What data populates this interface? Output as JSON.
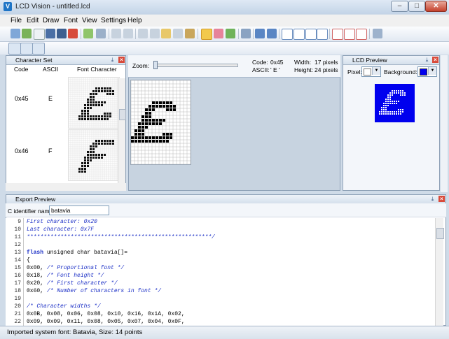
{
  "window": {
    "title": "LCD Vision - untitled.lcd",
    "app_icon_letter": "V"
  },
  "menu": [
    "File",
    "Edit",
    "Draw",
    "Font",
    "View",
    "Settings",
    "Help"
  ],
  "charset": {
    "title": "Character Set",
    "headers": {
      "code": "Code",
      "ascii": "ASCII",
      "font_character": "Font Character"
    },
    "rows": [
      {
        "code": "0x45",
        "ascii": "E"
      },
      {
        "code": "0x46",
        "ascii": "F"
      }
    ]
  },
  "editor": {
    "zoom_label": "Zoom:",
    "code_label": "Code:",
    "code_value": "0x45",
    "ascii_label": "ASCII:",
    "ascii_value": "' E '",
    "width_label": "Width:",
    "width_value": "17 pixels",
    "height_label": "Height:",
    "height_value": "24 pixels"
  },
  "preview": {
    "title": "LCD Preview",
    "pixel_label": "Pixel:",
    "background_label": "Background:",
    "pixel_color": "#ffffff",
    "background_color": "#0000ee"
  },
  "export": {
    "title": "Export Preview",
    "identifier_label": "C identifier name:",
    "identifier_value": "batavia",
    "lines": [
      {
        "n": "9",
        "text": "First character: 0x20",
        "style": "com"
      },
      {
        "n": "10",
        "text": "Last character: 0x7F",
        "style": "com"
      },
      {
        "n": "11",
        "text": "*******************************************************/",
        "style": "com"
      },
      {
        "n": "12",
        "text": "",
        "style": "plain"
      },
      {
        "n": "13",
        "text": "flash unsigned char batavia[]=",
        "style": "kw"
      },
      {
        "n": "14",
        "text": "{",
        "style": "plain"
      },
      {
        "n": "15",
        "text": "0x00, /* Proportional font */",
        "style": "mixed"
      },
      {
        "n": "16",
        "text": "0x18, /* Font height */",
        "style": "mixed"
      },
      {
        "n": "17",
        "text": "0x20, /* First character */",
        "style": "mixed"
      },
      {
        "n": "18",
        "text": "0x60, /* Number of characters in font */",
        "style": "mixed"
      },
      {
        "n": "19",
        "text": "",
        "style": "plain"
      },
      {
        "n": "20",
        "text": "/* Character widths */",
        "style": "com"
      },
      {
        "n": "21",
        "text": "0x0B, 0x08, 0x06, 0x08, 0x10, 0x16, 0x1A, 0x02,",
        "style": "plain"
      },
      {
        "n": "22",
        "text": "0x09, 0x09, 0x11, 0x08, 0x05, 0x07, 0x04, 0x0F,",
        "style": "plain"
      }
    ]
  },
  "status": {
    "text": "Imported system font: Batavia, Size: 14 points"
  },
  "icons": {
    "toolbar1": [
      "import-font-icon",
      "export-font-icon",
      "new-icon",
      "save-icon",
      "save-as-icon",
      "close-doc-icon",
      "settings-icon",
      "undo-icon",
      "redo-icon",
      "cut-icon",
      "copy-icon",
      "paste-icon",
      "delete-icon",
      "clipboard-icon",
      "pencil-icon",
      "eraser-icon",
      "fill-icon",
      "select-icon",
      "shift-icon",
      "flip-vertical-icon",
      "flip-horizontal-icon",
      "grid-icon-1",
      "grid-icon-2",
      "grid-icon-3",
      "grid-icon-4",
      "grid-icon-5",
      "grid-icon-6",
      "grid-icon-7",
      "font-settings-icon"
    ],
    "toolbar2": [
      "view-preview-icon",
      "view-font-icon",
      "view-charset-icon"
    ]
  }
}
